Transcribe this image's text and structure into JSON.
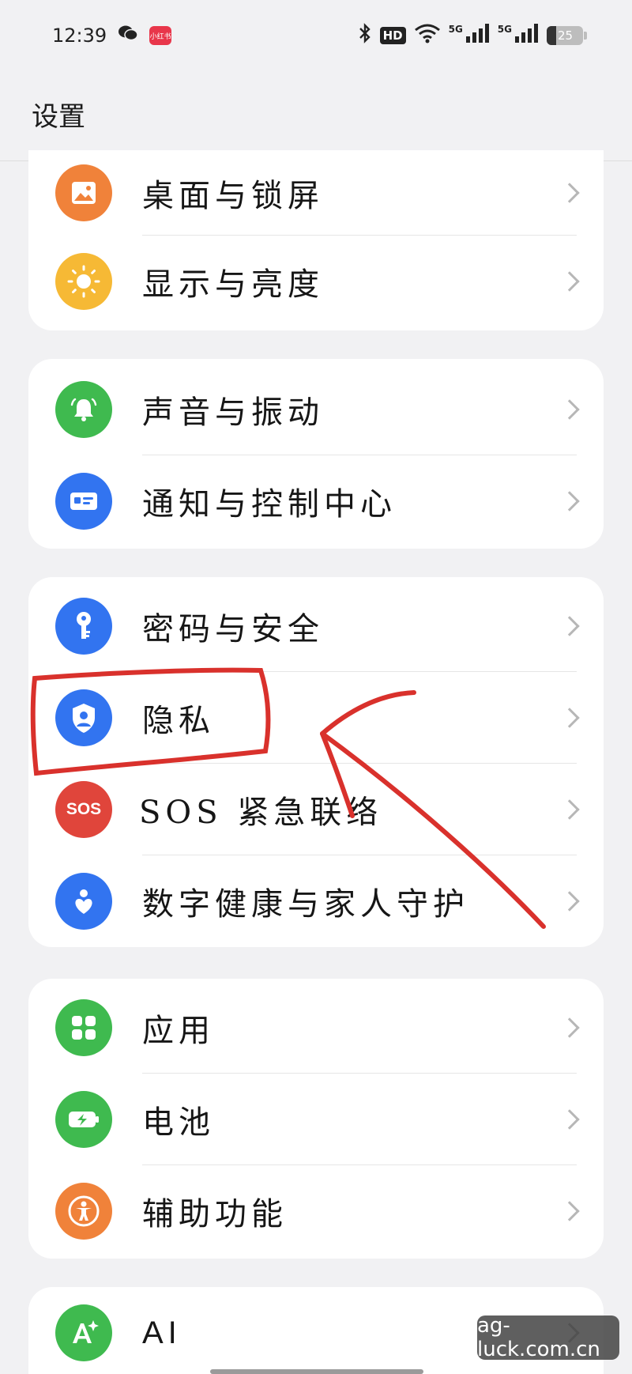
{
  "status_bar": {
    "time": "12:39",
    "app_badge": "小红书",
    "hd": "HD",
    "sig1": "5G",
    "sig2": "5G",
    "battery": "25"
  },
  "header": {
    "title": "设置"
  },
  "groups": [
    {
      "items": [
        {
          "label": "桌面与锁屏",
          "icon": "wallpaper-icon",
          "color": "#f0823a"
        },
        {
          "label": "显示与亮度",
          "icon": "sun-icon",
          "color": "#f6b935"
        }
      ]
    },
    {
      "items": [
        {
          "label": "声音与振动",
          "icon": "bell-icon",
          "color": "#3fba4f"
        },
        {
          "label": "通知与控制中心",
          "icon": "notification-icon",
          "color": "#3274f0"
        }
      ]
    },
    {
      "items": [
        {
          "label": "密码与安全",
          "icon": "key-icon",
          "color": "#3274f0"
        },
        {
          "label": "隐私",
          "icon": "privacy-shield-icon",
          "color": "#3274f0"
        },
        {
          "label": "SOS 紧急联络",
          "icon": "sos-icon",
          "color": "#e0453b",
          "icon_text": "SOS"
        },
        {
          "label": "数字健康与家人守护",
          "icon": "heart-person-icon",
          "color": "#3274f0"
        }
      ]
    },
    {
      "items": [
        {
          "label": "应用",
          "icon": "apps-grid-icon",
          "color": "#3fba4f"
        },
        {
          "label": "电池",
          "icon": "battery-icon",
          "color": "#3fba4f"
        },
        {
          "label": "辅助功能",
          "icon": "accessibility-icon",
          "color": "#f0823a"
        }
      ]
    },
    {
      "items": [
        {
          "label": "AI",
          "icon": "ai-sparkle-icon",
          "color": "#3fba4f"
        }
      ]
    }
  ],
  "watermark": "ag-luck.com.cn"
}
